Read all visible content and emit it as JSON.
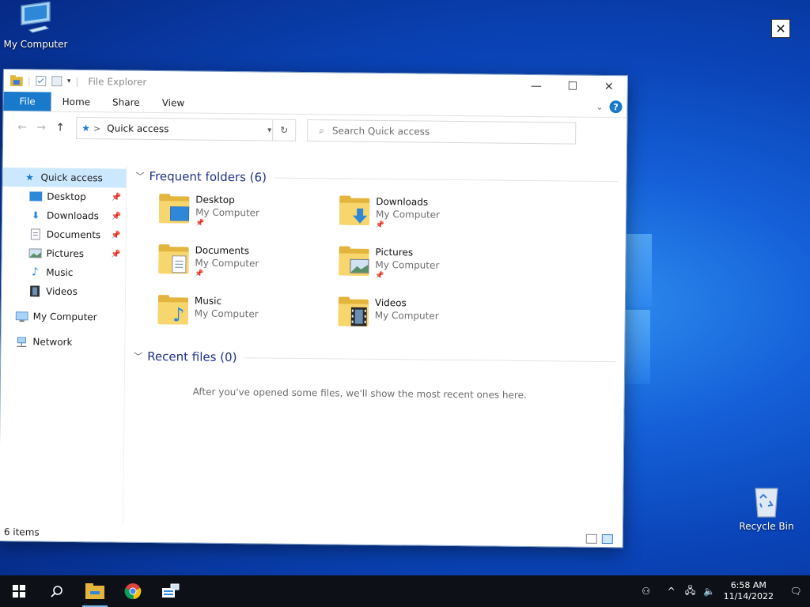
{
  "desktop": {
    "icons": [
      {
        "label": "My Computer"
      },
      {
        "label": "Recycle Bin"
      }
    ],
    "close_symbol": "✕"
  },
  "window": {
    "title": "File Explorer",
    "controls": {
      "minimize": "—",
      "maximize": "☐",
      "close": "✕"
    },
    "ribbon": {
      "tabs": [
        "File",
        "Home",
        "Share",
        "View"
      ]
    },
    "address": {
      "location": "Quick access",
      "separator": ">",
      "dropdown": "▾",
      "refresh": "↻"
    },
    "search": {
      "placeholder": "Search Quick access"
    },
    "nav": {
      "quick_access": "Quick access",
      "pinned": [
        "Desktop",
        "Downloads",
        "Documents",
        "Pictures"
      ],
      "unpinned": [
        "Music",
        "Videos"
      ],
      "this_pc": "My Computer",
      "network": "Network"
    },
    "frequent": {
      "header": "Frequent folders (6)",
      "folders": [
        {
          "name": "Desktop",
          "location": "My Computer",
          "pinned": true,
          "icon": "desktop-overlay-icon"
        },
        {
          "name": "Downloads",
          "location": "My Computer",
          "pinned": true,
          "icon": "download-arrow-icon"
        },
        {
          "name": "Documents",
          "location": "My Computer",
          "pinned": true,
          "icon": "document-overlay-icon"
        },
        {
          "name": "Pictures",
          "location": "My Computer",
          "pinned": true,
          "icon": "picture-overlay-icon"
        },
        {
          "name": "Music",
          "location": "My Computer",
          "pinned": false,
          "icon": "music-note-icon"
        },
        {
          "name": "Videos",
          "location": "My Computer",
          "pinned": false,
          "icon": "film-strip-icon"
        }
      ]
    },
    "recent": {
      "header": "Recent files (0)",
      "empty_message": "After you've opened some files, we'll show the most recent ones here."
    },
    "status": {
      "items": "6 items"
    }
  },
  "taskbar": {
    "time": "6:58 AM",
    "date": "11/14/2022",
    "accent": "#76b9ed"
  },
  "colors": {
    "accent": "#1979ca",
    "selection": "#cce8ff",
    "folder": "#f6d66d",
    "taskbar": "#0d1117"
  }
}
